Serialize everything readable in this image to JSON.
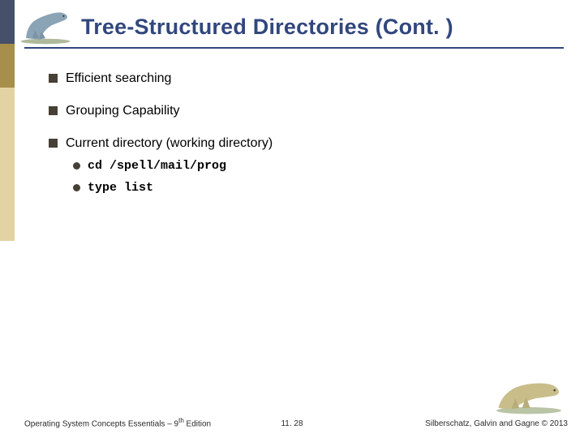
{
  "title": "Tree-Structured Directories (Cont. )",
  "bullets": {
    "b1": "Efficient searching",
    "b2": "Grouping Capability",
    "b3": "Current directory (working directory)",
    "b3_sub1": "cd /spell/mail/prog",
    "b3_sub2": "type list"
  },
  "footer": {
    "left_prefix": "Operating System Concepts Essentials – 9",
    "left_sup": "th",
    "left_suffix": " Edition",
    "center": "11. 28",
    "right": "Silberschatz, Galvin and Gagne © 2013"
  }
}
